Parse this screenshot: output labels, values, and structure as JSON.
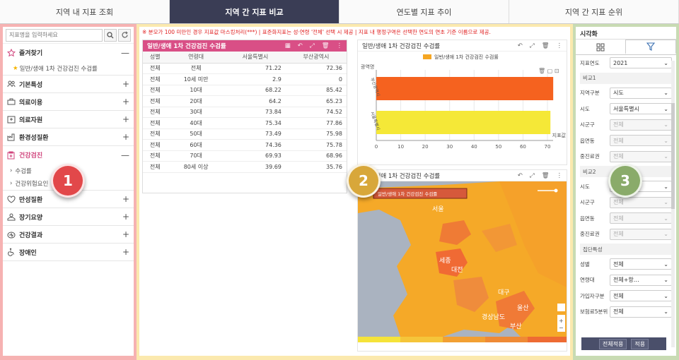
{
  "tabs": [
    "지역 내 지표 조회",
    "지역 간 지표 비교",
    "연도별 지표 추이",
    "지역 간 지표 순위"
  ],
  "left": {
    "search_placeholder": "지표명을 입력하세요",
    "favorites": {
      "label": "즐겨찾기",
      "item": "일반/생애 1차 건강검진 수검률"
    },
    "items": [
      "기본특성",
      "의료이용",
      "의료자원",
      "환경성질환",
      "건강검진",
      "만성질환",
      "장기요양",
      "건강결과",
      "장애인"
    ],
    "health_sub": [
      "수검률",
      "건강위험요인"
    ]
  },
  "mid": {
    "notice": "※ 분모가 100 미만인 경우 지표값 마스킹처리(***) | 표준화지표는 성·연령 '전체' 선택 시 제공 | 지표 내 행정구역은 선택한 연도의 연초 기준 이름으로 제공.",
    "table": {
      "title": "일반/생애 1차 건강검진 수검률",
      "headers": [
        "성별",
        "연령대",
        "서울특별시",
        "부산광역시"
      ],
      "rows": [
        [
          "전체",
          "전체",
          "71.22",
          "72.36"
        ],
        [
          "전체",
          "10세 미만",
          "2.9",
          "0"
        ],
        [
          "전체",
          "10대",
          "68.22",
          "85.42"
        ],
        [
          "전체",
          "20대",
          "64.2",
          "65.23"
        ],
        [
          "전체",
          "30대",
          "73.84",
          "74.52"
        ],
        [
          "전체",
          "40대",
          "75.34",
          "77.86"
        ],
        [
          "전체",
          "50대",
          "73.49",
          "75.98"
        ],
        [
          "전체",
          "60대",
          "74.36",
          "75.78"
        ],
        [
          "전체",
          "70대",
          "69.93",
          "68.96"
        ],
        [
          "전체",
          "80세 이상",
          "39.69",
          "35.76"
        ]
      ]
    },
    "bar": {
      "title": "일반/생애 1차 건강검진 수검률",
      "legend": "일반/생애 1차 건강검진 수검률",
      "ylabel": "광역명",
      "xlabel": "지표값"
    },
    "map": {
      "title": "일반/생애 1차 건강검진 수검률",
      "legend_box": "일반/생애 1차 건강검진 수검률",
      "labels": [
        {
          "t": "서울"
        },
        {
          "t": "세종"
        },
        {
          "t": "대전"
        },
        {
          "t": "대구"
        },
        {
          "t": "울산"
        },
        {
          "t": "부산"
        },
        {
          "t": "경상남도"
        }
      ]
    }
  },
  "chart_data": {
    "type": "bar",
    "orientation": "horizontal",
    "categories": [
      "부산광역시",
      "서울특별시"
    ],
    "series": [
      {
        "name": "일반/생애 1차 건강검진 수검률",
        "values": [
          72.36,
          71.22
        ]
      }
    ],
    "xlim": [
      0,
      70
    ],
    "xticks": [
      0,
      10,
      20,
      30,
      40,
      50,
      60,
      70
    ],
    "colors": [
      "#f5621f",
      "#f5e837"
    ]
  },
  "right": {
    "title": "시각화",
    "year": {
      "label": "지표연도",
      "value": "2021"
    },
    "comp1": {
      "label": "비교1",
      "rows": [
        [
          "지역구분",
          "시도",
          false
        ],
        [
          "시도",
          "서울특별시",
          false
        ],
        [
          "시군구",
          "전체",
          true
        ],
        [
          "읍면동",
          "전체",
          true
        ],
        [
          "중진료권",
          "전체",
          true
        ]
      ]
    },
    "comp2": {
      "label": "비교2",
      "rows": [
        [
          "시도",
          "부산광역시",
          false
        ],
        [
          "시군구",
          "전체",
          true
        ],
        [
          "읍면동",
          "전체",
          true
        ],
        [
          "중진료권",
          "전체",
          true
        ]
      ]
    },
    "group": {
      "label": "집단특성",
      "rows": [
        [
          "성별",
          "전체",
          false
        ],
        [
          "연령대",
          "전체+항…",
          false
        ],
        [
          "가입자구분",
          "전체",
          false
        ],
        [
          "보험료5분위",
          "전체",
          false
        ]
      ]
    },
    "btn_all": "전체적용",
    "btn_apply": "적용"
  },
  "badges": [
    "1",
    "2",
    "3"
  ]
}
